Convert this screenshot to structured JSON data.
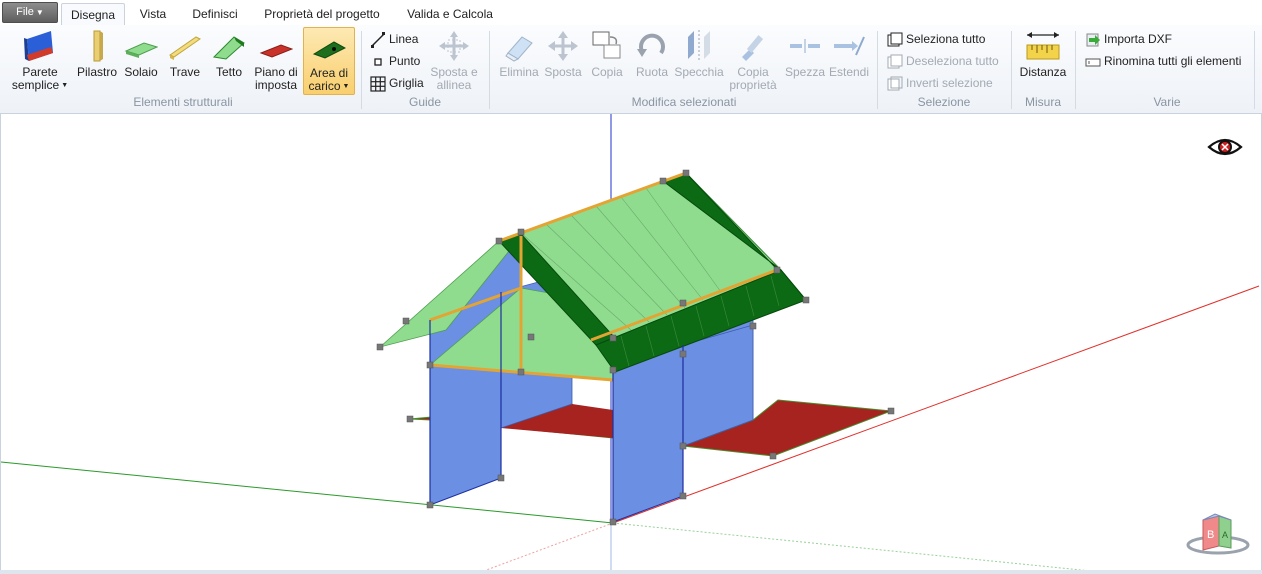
{
  "menu": {
    "file_label": "File"
  },
  "tabs": [
    {
      "label": "Disegna",
      "active": true
    },
    {
      "label": "Vista"
    },
    {
      "label": "Definisci"
    },
    {
      "label": "Proprietà del progetto"
    },
    {
      "label": "Valida e Calcola"
    }
  ],
  "groups": {
    "elementi": {
      "label": "Elementi strutturali",
      "parete": [
        "Parete",
        "semplice"
      ],
      "pilastro": "Pilastro",
      "solaio": "Solaio",
      "trave": "Trave",
      "tetto": "Tetto",
      "piano": [
        "Piano di",
        "imposta"
      ],
      "area": [
        "Area di",
        "carico"
      ]
    },
    "guide": {
      "label": "Guide",
      "linea": "Linea",
      "punto": "Punto",
      "griglia": "Griglia",
      "sposta": [
        "Sposta e",
        "allinea"
      ]
    },
    "modifica": {
      "label": "Modifica selezionati",
      "elimina": "Elimina",
      "sposta": "Sposta",
      "copia": "Copia",
      "ruota": "Ruota",
      "specchia": "Specchia",
      "copia_prop": [
        "Copia",
        "proprietà"
      ],
      "spezza": "Spezza",
      "estendi": "Estendi"
    },
    "selezione": {
      "label": "Selezione",
      "seleziona": "Seleziona tutto",
      "deseleziona": "Deseleziona tutto",
      "inverti": "Inverti selezione"
    },
    "misura": {
      "label": "Misura",
      "distanza": "Distanza"
    },
    "varie": {
      "label": "Varie",
      "importa": "Importa DXF",
      "rinomina": "Rinomina tutti gli elementi"
    }
  },
  "viewcube": {
    "face_b": "B",
    "face_a": "A"
  },
  "colors": {
    "wall": "#6a8fe3",
    "roof_light": "#90e090",
    "roof_dark": "#0c6a14",
    "floor_red": "#a6231f",
    "beam": "#e3a433",
    "axis_x": "#e0302a",
    "axis_y": "#2a9a2a",
    "axis_z": "#2233cc"
  }
}
